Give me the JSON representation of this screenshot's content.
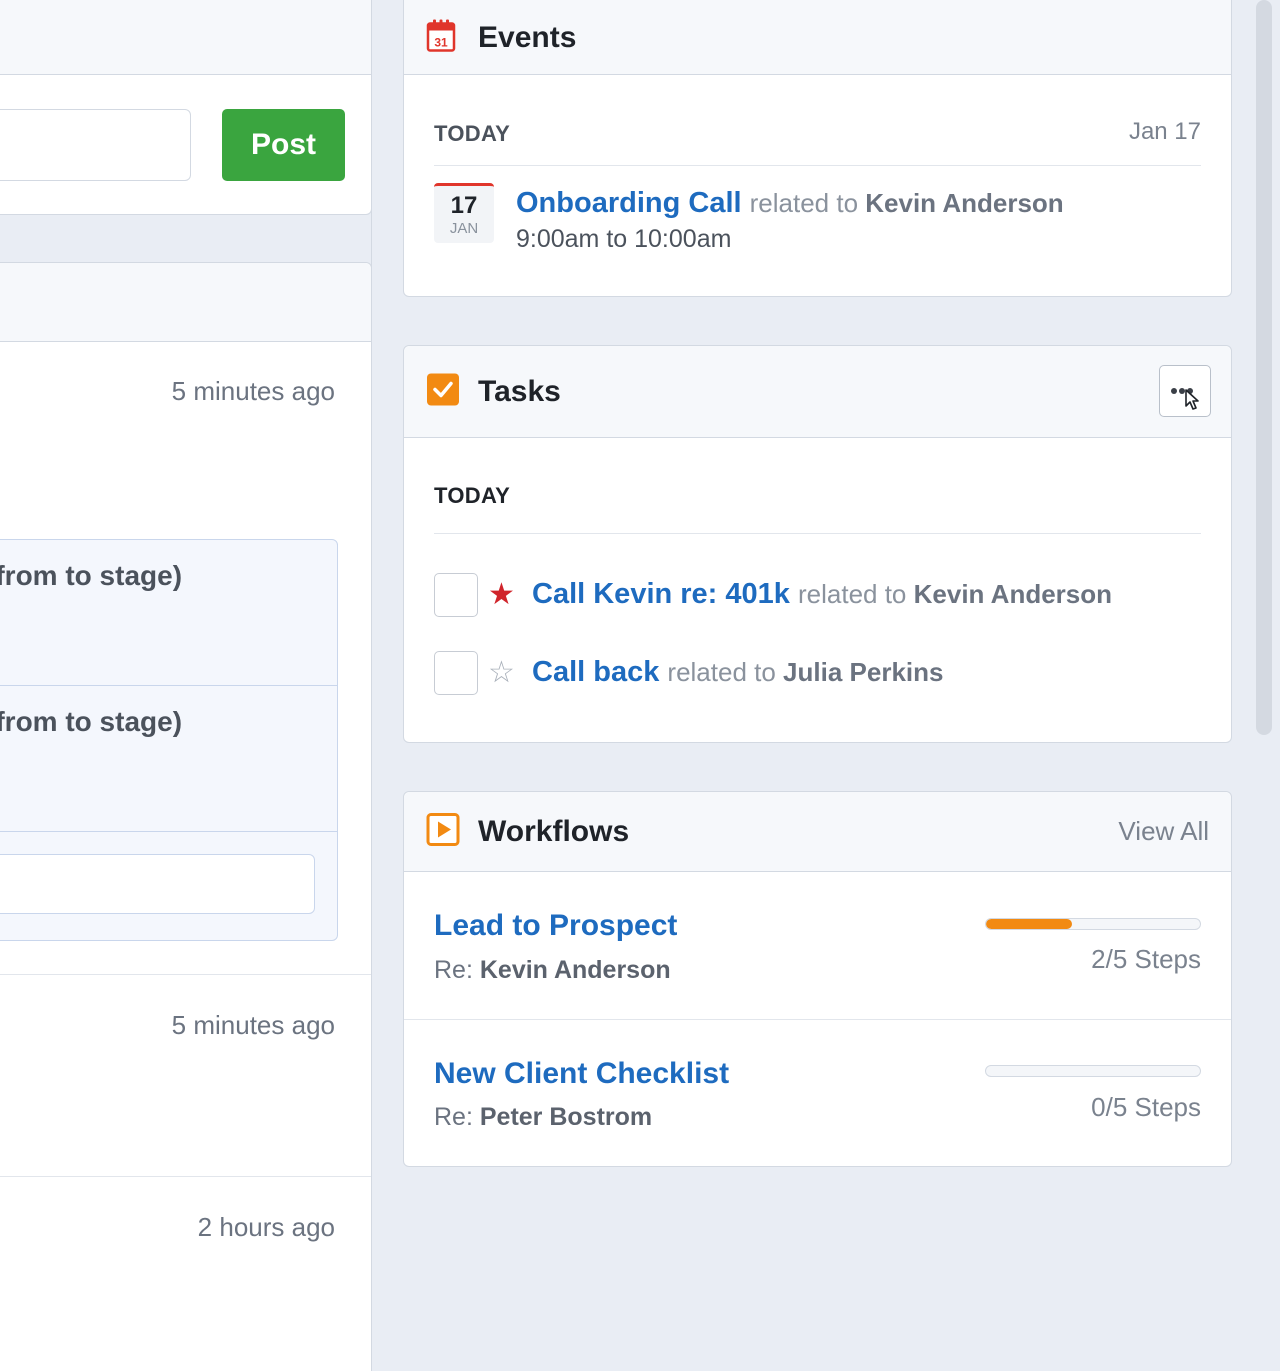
{
  "composer": {
    "post_label": "Post"
  },
  "feed": {
    "items": [
      {
        "time": "5 minutes ago"
      },
      {
        "time": "5 minutes ago"
      },
      {
        "time": "2 hours ago"
      }
    ],
    "stage_rows": [
      {
        "text": "y from to stage)"
      },
      {
        "text": "y from to stage)"
      }
    ]
  },
  "events": {
    "title": "Events",
    "icon": "calendar-icon",
    "section": "TODAY",
    "date": "Jan 17",
    "item": {
      "day": "17",
      "month": "JAN",
      "name": "Onboarding Call",
      "related_to_text": "related to",
      "related": "Kevin Anderson",
      "time": "9:00am to 10:00am"
    }
  },
  "tasks": {
    "title": "Tasks",
    "icon": "checkbox-icon",
    "section": "TODAY",
    "items": [
      {
        "name": "Call Kevin re: 401k",
        "related_to_text": "related to",
        "related": "Kevin Anderson",
        "starred": true
      },
      {
        "name": "Call back",
        "related_to_text": "related to",
        "related": "Julia Perkins",
        "starred": false
      }
    ]
  },
  "workflows": {
    "title": "Workflows",
    "icon": "play-icon",
    "view_all": "View All",
    "items": [
      {
        "name": "Lead to Prospect",
        "re_label": "Re:",
        "re": "Kevin Anderson",
        "steps": "2/5 Steps",
        "progress": 0.4
      },
      {
        "name": "New Client Checklist",
        "re_label": "Re:",
        "re": "Peter Bostrom",
        "steps": "0/5 Steps",
        "progress": 0
      }
    ]
  },
  "colors": {
    "accent": "#1e6bbf",
    "post": "#3aa53f",
    "progress": "#f28a12",
    "star": "#d0242b",
    "events_icon": "#e0352b",
    "tasks_icon": "#f28a12"
  }
}
